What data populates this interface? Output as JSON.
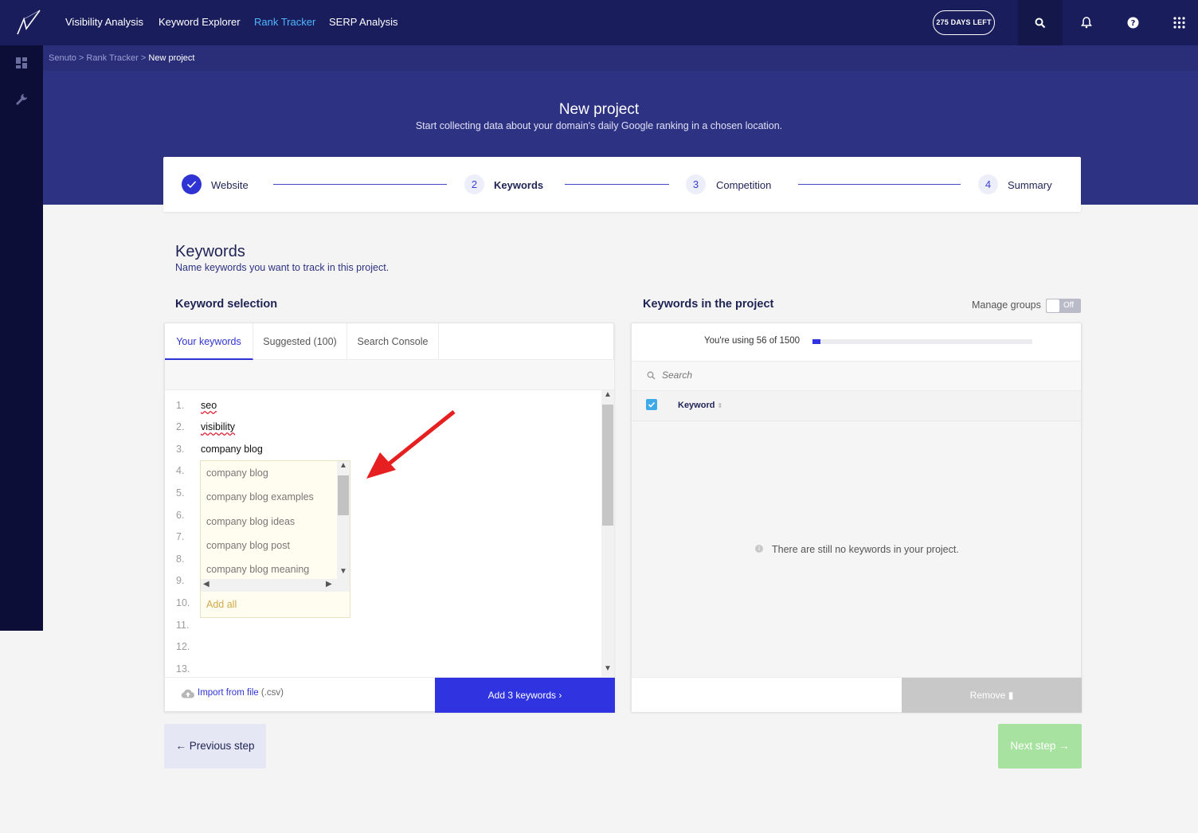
{
  "nav": {
    "items": [
      {
        "label": "Visibility Analysis",
        "active": false
      },
      {
        "label": "Keyword Explorer",
        "active": false
      },
      {
        "label": "Rank Tracker",
        "active": true
      },
      {
        "label": "SERP Analysis",
        "active": false
      }
    ],
    "days_left": "275 DAYS LEFT",
    "icons": [
      "search-icon",
      "bell-icon",
      "help-icon",
      "apps-grid-icon"
    ]
  },
  "sidebar": {
    "icons": [
      "dashboard-icon",
      "wrench-icon"
    ]
  },
  "breadcrumb": {
    "root": "Senuto",
    "sep": " > ",
    "parent": "Rank Tracker",
    "current": "New project"
  },
  "hero": {
    "title": "New project",
    "subtitle": "Start collecting data about your domain's daily Google ranking in a chosen location."
  },
  "stepper": {
    "steps": [
      {
        "num": "",
        "label": "Website",
        "state": "done"
      },
      {
        "num": "2",
        "label": "Keywords",
        "state": "current"
      },
      {
        "num": "3",
        "label": "Competition",
        "state": "todo"
      },
      {
        "num": "4",
        "label": "Summary",
        "state": "todo"
      }
    ]
  },
  "section": {
    "title": "Keywords",
    "subtitle": "Name keywords you want to track in this project."
  },
  "left": {
    "heading": "Keyword selection",
    "tabs": [
      "Your keywords",
      "Suggested (100)",
      "Search Console"
    ],
    "line_numbers": [
      "1.",
      "2.",
      "3.",
      "4.",
      "5.",
      "6.",
      "7.",
      "8.",
      "9.",
      "10.",
      "11.",
      "12.",
      "13."
    ],
    "keywords": [
      "seo",
      "visibility",
      "company blog"
    ],
    "suggestions": [
      "company blog",
      "company blog examples",
      "company blog ideas",
      "company blog post",
      "company blog meaning"
    ],
    "add_all": "Add all",
    "import_label": "Import from file",
    "import_ext": " (.csv)",
    "add_button": "Add 3 keywords ›"
  },
  "right": {
    "heading": "Keywords in the project",
    "manage_groups": "Manage groups",
    "toggle": "Off",
    "usage_text": "You're using 56 of 1500",
    "usage_fraction": 0.0373,
    "search_placeholder": "Search",
    "column_keyword": "Keyword",
    "empty_message": "There are still no keywords in your project.",
    "remove_button": "Remove"
  },
  "footer": {
    "prev": "← Previous step",
    "next": "Next step →"
  },
  "colors": {
    "nav_bg": "#1a1d5c",
    "hero_bg": "#2e3282",
    "accent": "#2f33e0",
    "active_link": "#4fb7ff",
    "next_disabled": "#a8e2a0"
  }
}
